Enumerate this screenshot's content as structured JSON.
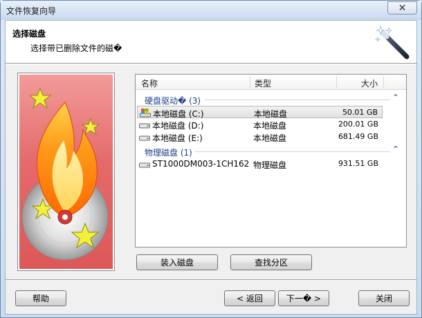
{
  "window": {
    "title": "文件恢复向导",
    "close_label": "✕"
  },
  "header": {
    "title": "选择磁盘",
    "subtitle": "选择带已删除文件的磁�"
  },
  "list": {
    "columns": {
      "name": "名称",
      "type": "类型",
      "size": "大小"
    },
    "groups": [
      {
        "label": "硬盘驱动� (3)",
        "rows": [
          {
            "name": "本地磁盘 (C:)",
            "type": "本地磁盘",
            "size": "50.01 GB",
            "selected": true,
            "icon": "system-drive-icon"
          },
          {
            "name": "本地磁盘 (D:)",
            "type": "本地磁盘",
            "size": "200.01 GB",
            "selected": false,
            "icon": "drive-icon"
          },
          {
            "name": "本地磁盘 (E:)",
            "type": "本地磁盘",
            "size": "681.49 GB",
            "selected": false,
            "icon": "drive-icon"
          }
        ]
      },
      {
        "label": "物理磁盘 (1)",
        "rows": [
          {
            "name": "ST1000DM003-1CH162",
            "type": "物理磁盘",
            "size": "931.51 GB",
            "selected": false,
            "icon": "drive-icon"
          }
        ]
      }
    ]
  },
  "buttons": {
    "mount": "装入磁盘",
    "find_partition": "查找分区",
    "help": "帮助",
    "back": "< 返回",
    "next": "下一� >",
    "close": "关闭"
  }
}
